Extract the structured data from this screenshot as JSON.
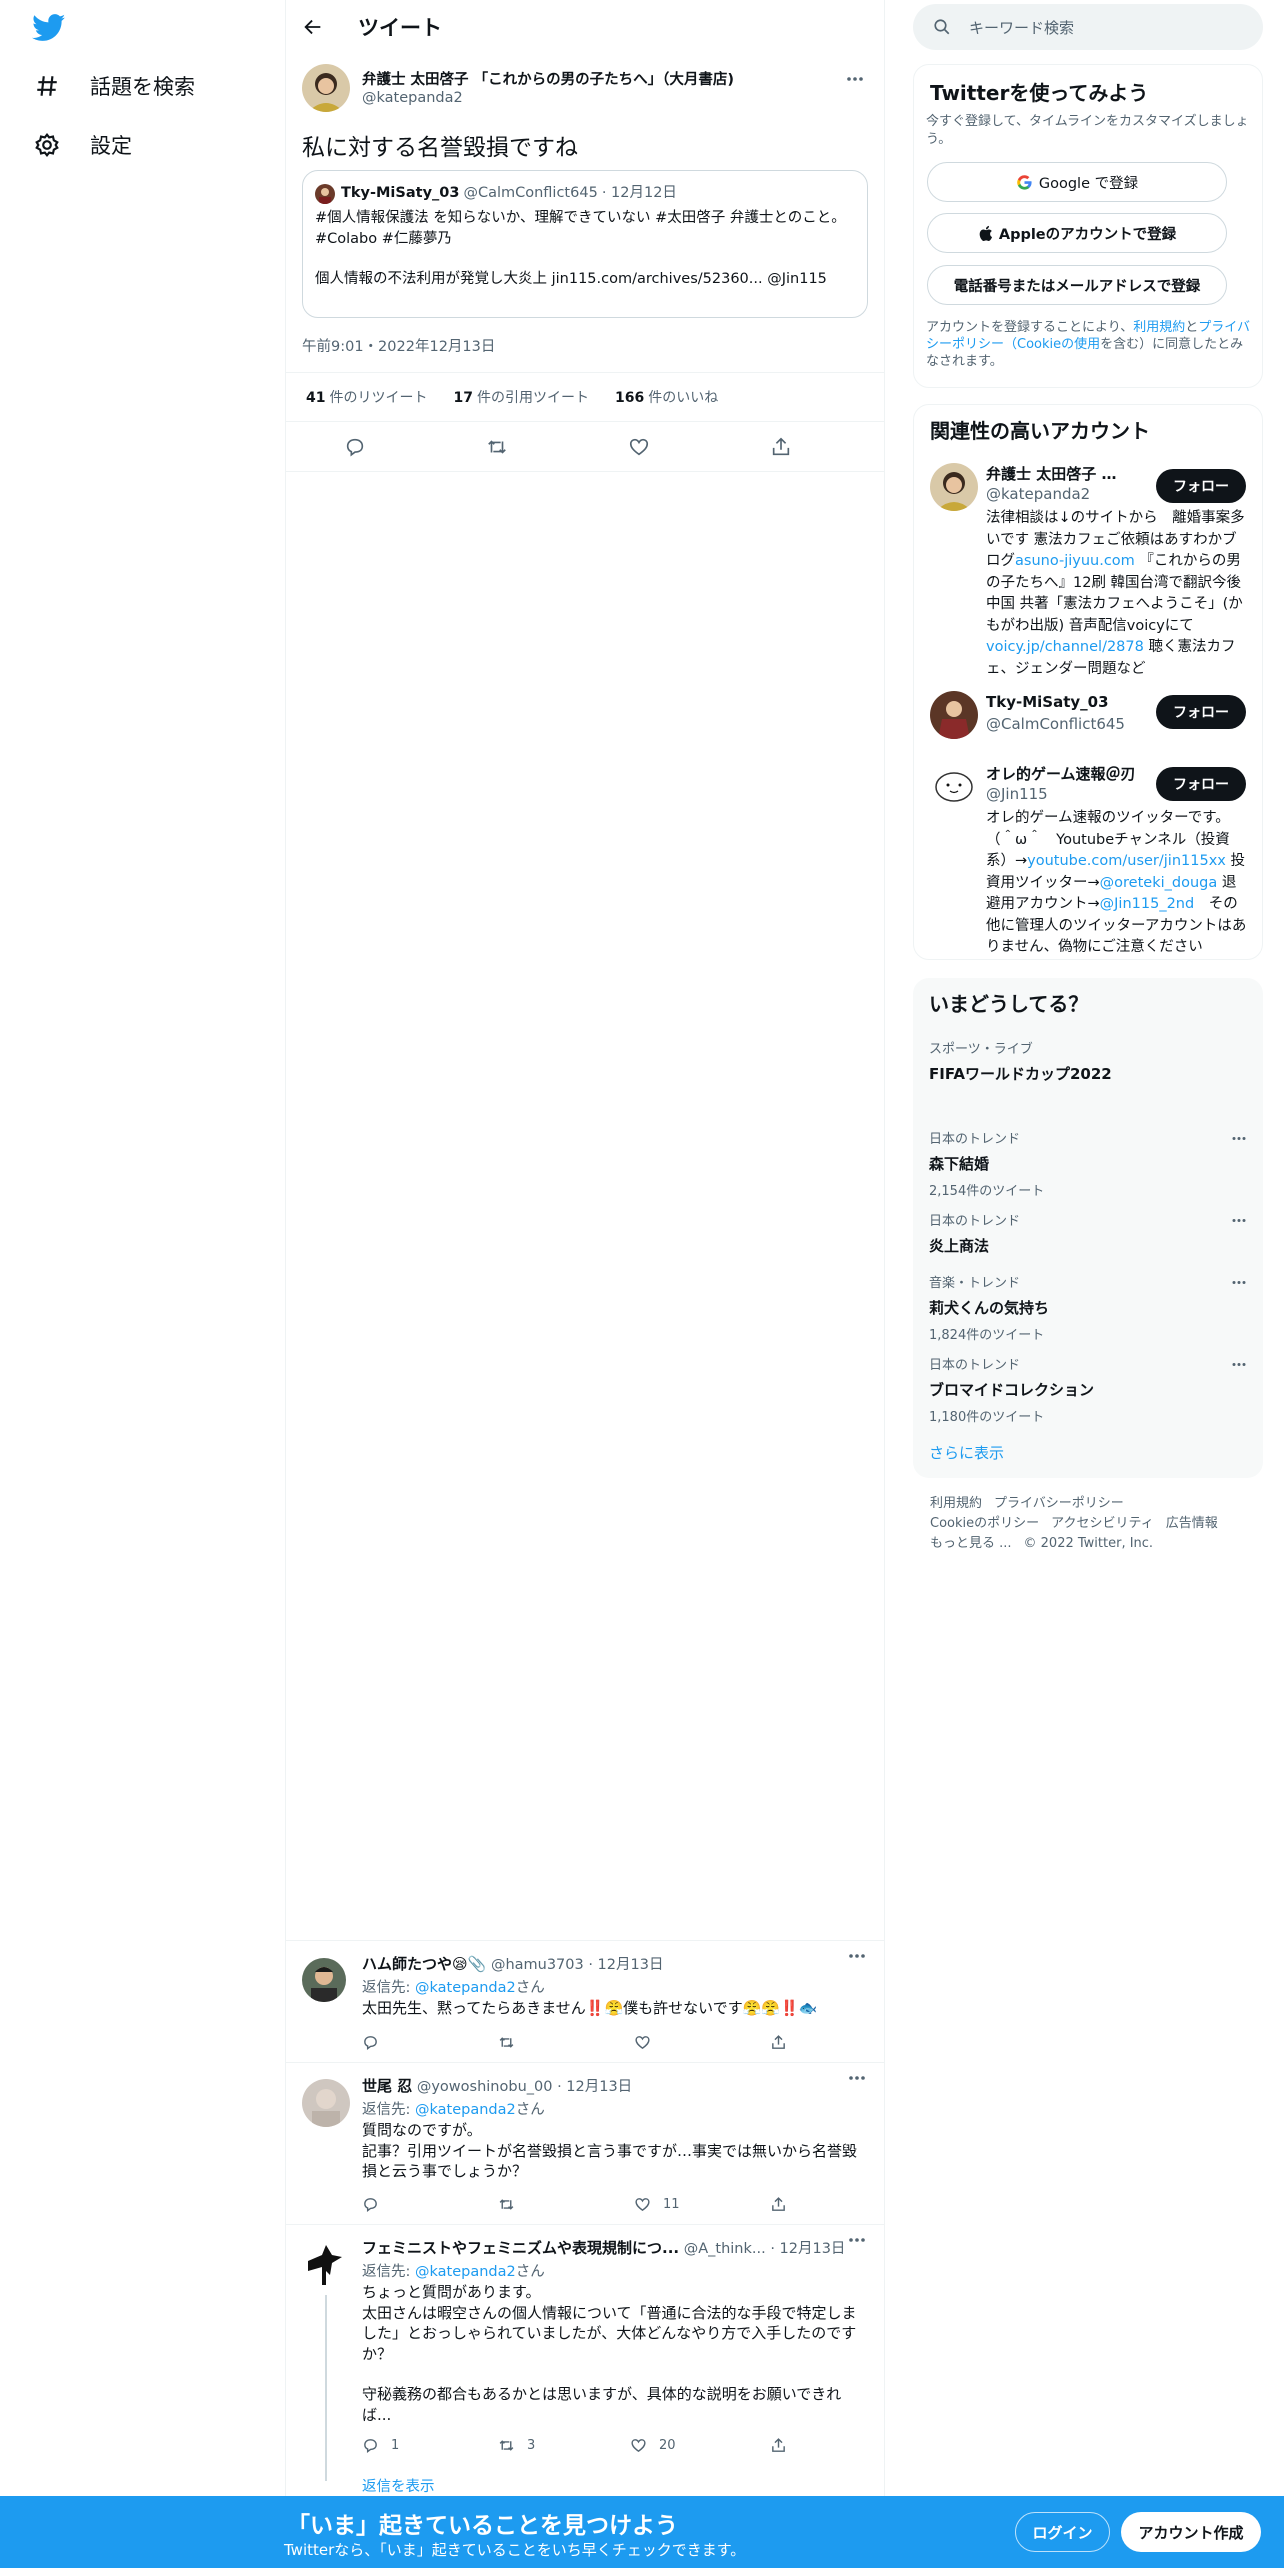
{
  "nav": {
    "explore_label": "話題を検索",
    "settings_label": "設定"
  },
  "header": {
    "title": "ツイート"
  },
  "tweet": {
    "author_name": "弁護士 太田啓子 「これからの男の子たちへ」（大月書店)",
    "author_handle": "@katepanda2",
    "text": "私に対する名誉毀損ですね",
    "quote": {
      "name": "Tky-MiSaty_03",
      "handle": "@CalmConflict645",
      "date": "· 12月12日",
      "line1": "#個人情報保護法 を知らないか、理解できていない #太田啓子 弁護士とのこと。",
      "line2": "#Colabo #仁藤夢乃",
      "line3": "個人情報の不法利用が発覚し大炎上  jin115.com/archives/52360... @Jin115"
    },
    "timestamp": "午前9:01・2022年12月13日",
    "retweets_num": "41",
    "retweets_label": "件のリツイート",
    "quotes_num": "17",
    "quotes_label": "件の引用ツイート",
    "likes_num": "166",
    "likes_label": "件のいいね"
  },
  "replies": [
    {
      "name": "ハム師たつや😪📎",
      "handle": "@hamu3703 · 12月13日",
      "reply_to_prefix": "返信先: ",
      "reply_to": "@katepanda2",
      "reply_to_suffix": "さん",
      "text": "太田先生、黙ってたらあきません‼️😤僕も許せないです😤😤‼️🐟",
      "likes": "",
      "retweets": "",
      "comments": ""
    },
    {
      "name": "世尾 忍",
      "handle": "@yowoshinobu_00 · 12月13日",
      "reply_to_prefix": "返信先: ",
      "reply_to": "@katepanda2",
      "reply_to_suffix": "さん",
      "text_l1": "質問なのですが。",
      "text_l2": "記事？引用ツイートが名誉毀損と言う事ですが…事実では無いから名誉毀損と云う事でしょうか？",
      "likes": "11",
      "retweets": "",
      "comments": ""
    },
    {
      "name": "フェミニストやフェミニズムや表現規制につ...",
      "handle": "@A_think... · 12月13日",
      "reply_to_prefix": "返信先: ",
      "reply_to": "@katepanda2",
      "reply_to_suffix": "さん",
      "text_l1": "ちょっと質問があります。",
      "text_l2": "太田さんは暇空さんの個人情報について「普通に合法的な手段で特定しました」とおっしゃられていましたが、大体どんなやり方で入手したのですか？",
      "text_l3": "守秘義務の都合もあるかとは思いますが、具体的な説明をお願いできれば...",
      "comments": "1",
      "retweets": "3",
      "likes": "20",
      "show_replies": "返信を表示"
    }
  ],
  "search": {
    "placeholder": "キーワード検索"
  },
  "signup_card": {
    "title": "Twitterを使ってみよう",
    "subtitle": "今すぐ登録して、タイムラインをカスタマイズしましょう。",
    "google": "Google で登録",
    "apple": "Appleのアカウントで登録",
    "phone": "電話番号またはメールアドレスで登録",
    "terms_prefix": "アカウントを登録することにより、",
    "terms_link": "利用規約",
    "terms_mid": "と",
    "privacy_link": "プライバシーポリシー（Cookieの使用",
    "terms_suffix": "を含む）に同意したとみなされます。"
  },
  "relevant": {
    "title": "関連性の高いアカウント",
    "follow_label": "フォロー",
    "accounts": [
      {
        "name": "弁護士 太田啓子 「...",
        "handle": "@katepanda2",
        "bio_1": "法律相談は↓のサイトから　離婚事案多いです 憲法カフェご依頼はあすわかブログ",
        "bio_link1": "asuno-jiyuu.com",
        "bio_2": " 『これからの男の子たちへ』12刷 韓国台湾で翻訳今後中国 共著「憲法カフェへようこそ」(かもがわ出版) 音声配信voicyにて　",
        "bio_link2": "voicy.jp/channel/2878",
        "bio_3": " 聴く憲法カフェ、ジェンダー問題など"
      },
      {
        "name": "Tky-MiSaty_03",
        "handle": "@CalmConflict645"
      },
      {
        "name": "オレ的ゲーム速報＠刃",
        "handle": "@Jin115",
        "bio_1": "オレ的ゲーム速報のツイッターです。（＾ω＾　Youtubeチャンネル（投資系）→",
        "bio_link1": "youtube.com/user/jin115xx",
        "bio_2": " 投資用ツイッター→",
        "bio_link2": "@oreteki_douga",
        "bio_3": " 退避用アカウント→",
        "bio_link3": "@Jin115_2nd",
        "bio_4": "　その他に管理人のツイッターアカウントはありません、偽物にご注意ください"
      }
    ]
  },
  "trends": {
    "title": "いまどうしてる？",
    "items": [
      {
        "category": "スポーツ・ライブ",
        "name": "FIFAワールドカップ2022",
        "count": ""
      },
      {
        "category": "日本のトレンド",
        "name": "森下結婚",
        "count": "2,154件のツイート"
      },
      {
        "category": "日本のトレンド",
        "name": "炎上商法",
        "count": ""
      },
      {
        "category": "音楽・トレンド",
        "name": "莉犬くんの気持ち",
        "count": "1,824件のツイート"
      },
      {
        "category": "日本のトレンド",
        "name": "ブロマイドコレクション",
        "count": "1,180件のツイート"
      }
    ],
    "show_more": "さらに表示"
  },
  "footer": {
    "terms": "利用規約",
    "privacy": "プライバシーポリシー",
    "cookie": "Cookieのポリシー",
    "accessibility": "アクセシビリティ",
    "ads": "広告情報",
    "more": "もっと見る ...",
    "copyright": "© 2022 Twitter, Inc."
  },
  "banner": {
    "headline": "「いま」起きていることを見つけよう",
    "sub": "Twitterなら、「いま」起きていることをいち早くチェックできます。",
    "login": "ログイン",
    "signup": "アカウント作成"
  },
  "colors": {
    "brand": "#1d9bf0",
    "text": "#0f1419",
    "muted": "#536471",
    "border": "#eff3f4"
  }
}
